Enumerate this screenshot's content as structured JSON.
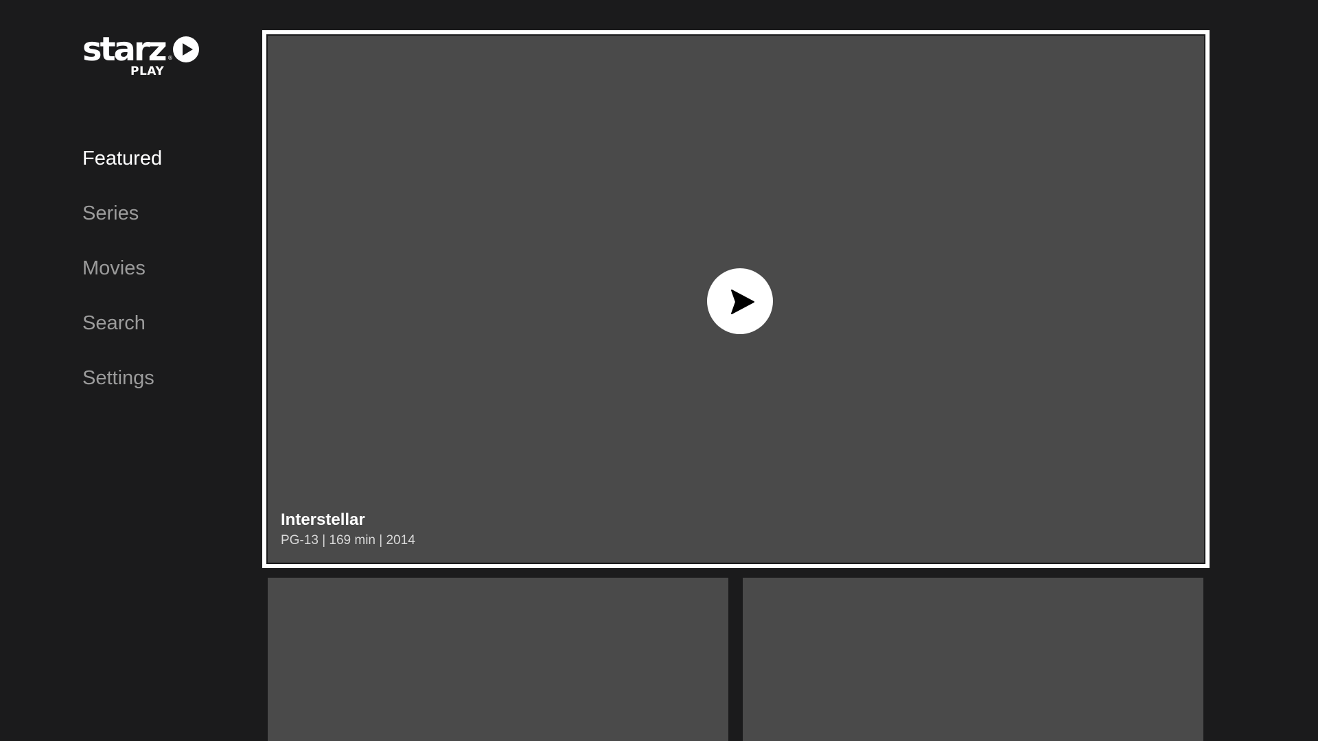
{
  "brand": {
    "logo_word": "starz",
    "logo_sub": "PLAY",
    "registered_mark": "®",
    "logo_icon": "play-circle-icon"
  },
  "nav": {
    "items": [
      {
        "label": "Featured",
        "active": true
      },
      {
        "label": "Series",
        "active": false
      },
      {
        "label": "Movies",
        "active": false
      },
      {
        "label": "Search",
        "active": false
      },
      {
        "label": "Settings",
        "active": false
      }
    ]
  },
  "hero": {
    "title": "Interstellar",
    "meta": "PG-13 | 169 min | 2014",
    "play_icon": "play-icon"
  },
  "colors": {
    "background": "#1b1b1c",
    "tile": "#4a4a4a",
    "focus_border": "#ffffff",
    "nav_active": "#ffffff",
    "nav_inactive": "#9b9b9b"
  }
}
